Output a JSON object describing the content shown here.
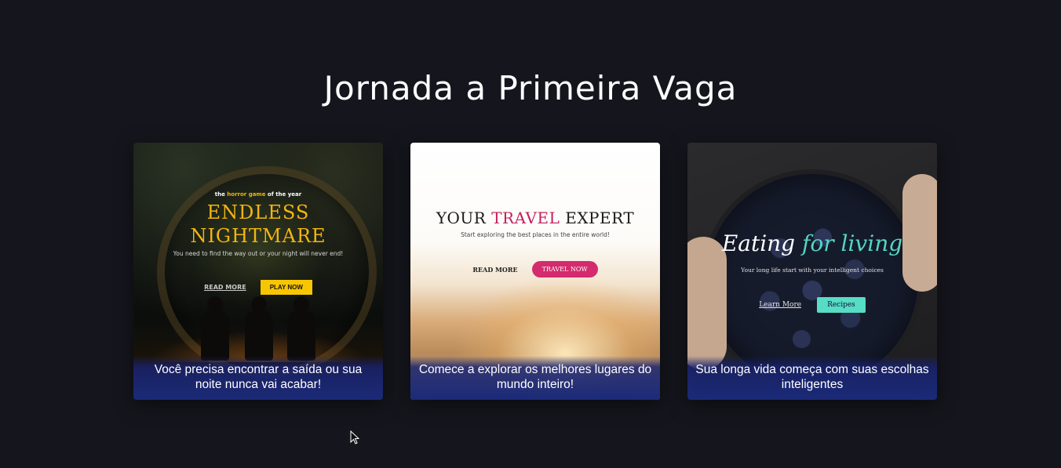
{
  "page": {
    "title": "Jornada a Primeira Vaga"
  },
  "cards": [
    {
      "kicker_pre": "the ",
      "kicker_highlight": "horror game",
      "kicker_post": " of the year",
      "title_line1": "ENDLESS",
      "title_line2": "NIGHTMARE",
      "subtitle": "You need to find the way out or your night will never end!",
      "secondary_label": "READ MORE",
      "primary_label": "PLAY NOW",
      "caption": "Você precisa encontrar a saída ou sua noite nunca vai acabar!"
    },
    {
      "title_pre": "YOUR ",
      "title_accent": "TRAVEL",
      "title_post": " EXPERT",
      "subtitle": "Start exploring the best places in the entire world!",
      "secondary_label": "READ MORE",
      "primary_label": "TRAVEL NOW",
      "caption": "Comece a explorar os melhores lugares do mundo inteiro!"
    },
    {
      "title_pre": "Eating ",
      "title_accent": "for living",
      "subtitle": "Your long life start with  your intelligent choices",
      "secondary_label": "Learn More",
      "primary_label": "Recipes",
      "caption": "Sua longa vida começa com suas escolhas inteligentes"
    }
  ],
  "colors": {
    "background": "#15161d",
    "horror_accent": "#f2b705",
    "travel_accent": "#d42a6e",
    "food_accent": "#57dcc6",
    "caption_bg": "#1b2a78"
  }
}
